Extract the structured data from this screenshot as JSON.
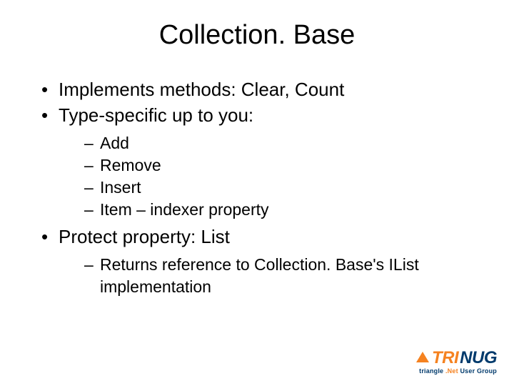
{
  "title": "Collection. Base",
  "bullets": {
    "b1": "Implements methods: Clear, Count",
    "b2": "Type-specific up to you:",
    "b2_sub": {
      "s1": "Add",
      "s2": "Remove",
      "s3": "Insert",
      "s4": "Item – indexer property"
    },
    "b3": "Protect property: List",
    "b3_sub": {
      "s1": "Returns reference to Collection. Base's IList implementation"
    }
  },
  "logo": {
    "part1": "TRI",
    "part2": "NUG",
    "sub_pre": "triangle",
    "sub_mid": " .Net ",
    "sub_post": "User Group"
  }
}
